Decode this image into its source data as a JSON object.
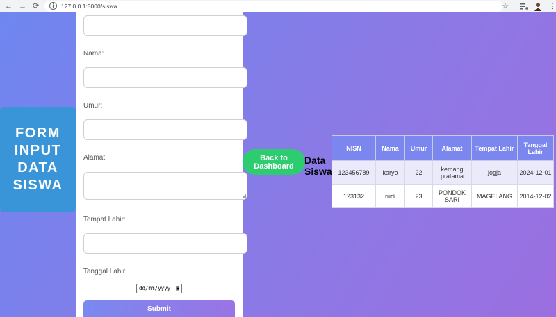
{
  "browser": {
    "url": "127.0.0.1:5000/siswa",
    "back_icon": "←",
    "forward_icon": "→",
    "reload_icon": "⟳",
    "info_icon": "i",
    "star_icon": "☆",
    "menu_icon": "⋮"
  },
  "title_card": {
    "text": "FORM\nINPUT\nDATA\nSISWA"
  },
  "form": {
    "labels": {
      "nama": "Nama:",
      "umur": "Umur:",
      "alamat": "Alamat:",
      "tempat_lahir": "Tempat Lahir:",
      "tanggal_lahir": "Tanggal Lahir:"
    },
    "date_placeholder": "dd/mm/yyyy",
    "submit_label": "Submit"
  },
  "back_button": {
    "label": "Back to Dashboard"
  },
  "data_title": "Data Siswa",
  "table": {
    "headers": [
      "NISN",
      "Nama",
      "Umur",
      "Alamat",
      "Tempat Lahir",
      "Tanggal Lahir"
    ],
    "rows": [
      [
        "123456789",
        "karyo",
        "22",
        "kemang pratama",
        "jogja",
        "2024-12-01"
      ],
      [
        "123132",
        "rudi",
        "23",
        "PONDOK SARI",
        "MAGELANG",
        "2014-12-02"
      ]
    ]
  },
  "colors": {
    "title_card": "#3a95d8",
    "back_button": "#2ecc71",
    "table_header": "#7b87ee",
    "background_start": "#6f86f0",
    "background_end": "#9b6fe0"
  }
}
